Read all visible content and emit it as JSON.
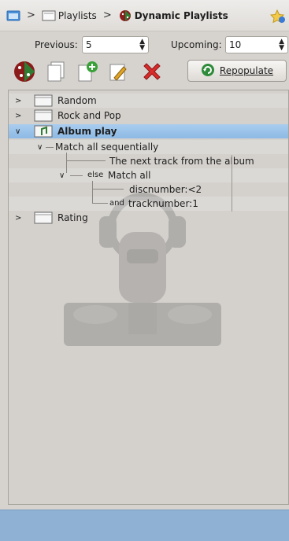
{
  "breadcrumb": {
    "items": [
      {
        "label": "Playlists"
      },
      {
        "label": "Dynamic Playlists"
      }
    ]
  },
  "navigation": {
    "previous_label": "Previous:",
    "previous_value": "5",
    "upcoming_label": "Upcoming:",
    "upcoming_value": "10"
  },
  "toolbar": {
    "repopulate_label": "Repopulate"
  },
  "tree": {
    "playlists": [
      {
        "label": "Random",
        "expanded": false
      },
      {
        "label": "Rock and Pop",
        "expanded": false
      },
      {
        "label": "Album play",
        "expanded": true,
        "selected": true
      },
      {
        "label": "Rating",
        "expanded": false
      }
    ],
    "album_play_biases": {
      "match_all_sequential": "Match all sequentially",
      "next_track": "The next track from the album",
      "else_prefix": "else",
      "match_all": "Match all",
      "discnumber": "discnumber:<2",
      "and_prefix": "and",
      "tracknumber": "tracknumber:1"
    }
  },
  "colors": {
    "selection": "#9cc4ea",
    "statusbar": "#8fb1d4",
    "background": "#d6d3cf"
  }
}
